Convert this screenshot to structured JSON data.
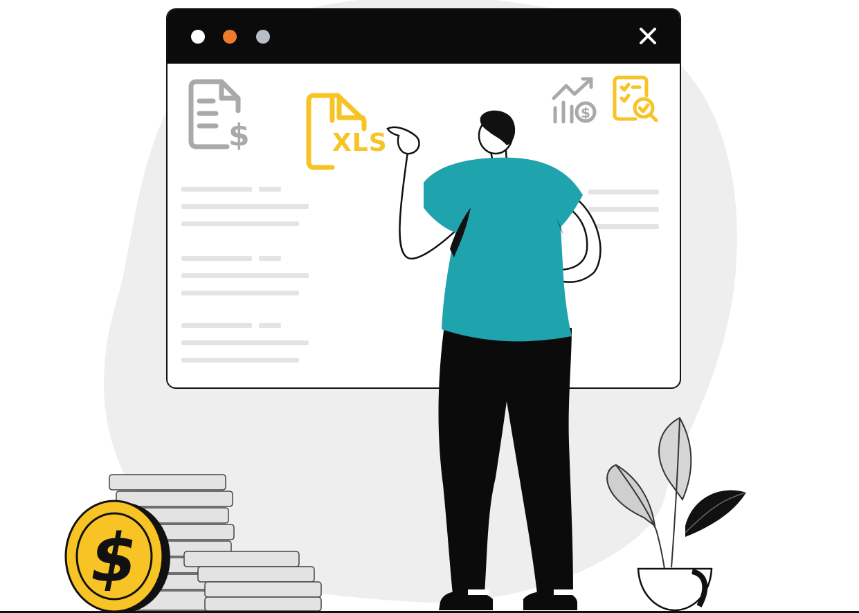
{
  "window": {
    "controls": {
      "dot_colors": [
        "#ffffff",
        "#f07b2d",
        "#b8bec6"
      ],
      "close_icon": "close-icon"
    }
  },
  "file_icons": {
    "invoice": "invoice-dollar-icon",
    "spreadsheet": {
      "icon": "xls-file-icon",
      "label": "XLS",
      "color": "#f7c325"
    },
    "growth": "growth-chart-dollar-icon",
    "audit": "checklist-search-icon"
  },
  "illustration": {
    "person": "person-pointing",
    "coins": "coin-stack",
    "coin_symbol": "$",
    "plant": "potted-plant"
  },
  "colors": {
    "accent_yellow": "#f7c325",
    "shirt_teal": "#1fa3ad",
    "titlebar": "#0b0b0b",
    "skeleton": "#e4e4e4",
    "blob": "#eeeeee"
  }
}
